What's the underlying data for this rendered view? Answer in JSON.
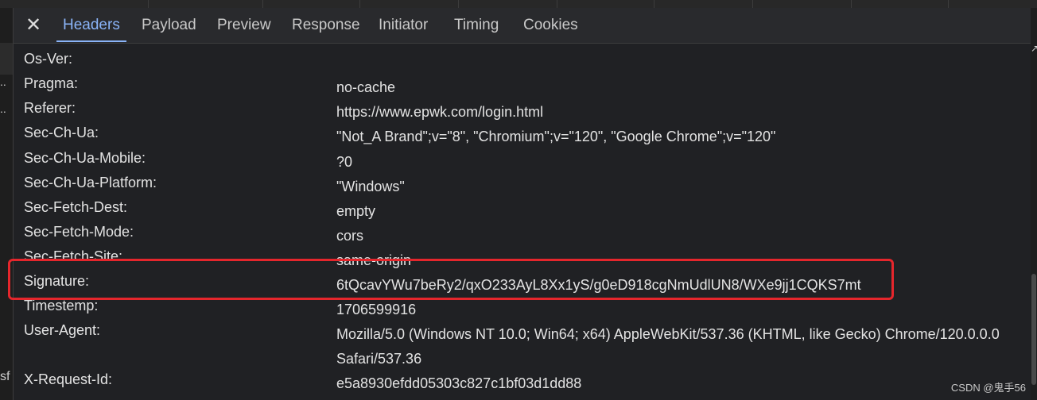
{
  "tabs": {
    "close_label": "✕",
    "items": [
      {
        "label": "Headers"
      },
      {
        "label": "Payload"
      },
      {
        "label": "Preview"
      },
      {
        "label": "Response"
      },
      {
        "label": "Initiator"
      },
      {
        "label": "Timing"
      },
      {
        "label": "Cookies"
      }
    ]
  },
  "gutter": {
    "marks": [
      "..",
      "..",
      "sf"
    ]
  },
  "headers": [
    {
      "key": "Os-Ver:",
      "value": ""
    },
    {
      "key": "Pragma:",
      "value": "no-cache"
    },
    {
      "key": "Referer:",
      "value": "https://www.epwk.com/login.html"
    },
    {
      "key": "Sec-Ch-Ua:",
      "value": "\"Not_A Brand\";v=\"8\", \"Chromium\";v=\"120\", \"Google Chrome\";v=\"120\""
    },
    {
      "key": "Sec-Ch-Ua-Mobile:",
      "value": "?0"
    },
    {
      "key": "Sec-Ch-Ua-Platform:",
      "value": "\"Windows\""
    },
    {
      "key": "Sec-Fetch-Dest:",
      "value": "empty"
    },
    {
      "key": "Sec-Fetch-Mode:",
      "value": "cors"
    },
    {
      "key": "Sec-Fetch-Site:",
      "value": "same-origin"
    },
    {
      "key": "Signature:",
      "value": "6tQcavYWu7beRy2/qxO233AyL8Xx1yS/g0eD918cgNmUdlUN8/WXe9jj1CQKS7mt"
    },
    {
      "key": "Timestemp:",
      "value": "1706599916"
    },
    {
      "key": "User-Agent:",
      "value": "Mozilla/5.0 (Windows NT 10.0; Win64; x64) AppleWebKit/537.36 (KHTML, like Gecko) Chrome/120.0.0.0 Safari/537.36"
    },
    {
      "key": "X-Request-Id:",
      "value": "e5a8930efdd05303c827c1bf03d1dd88"
    }
  ],
  "watermark": "CSDN @鬼手56",
  "colors": {
    "background": "#202124",
    "active_tab": "#8ab4f8",
    "highlight_box": "#e5262c"
  }
}
